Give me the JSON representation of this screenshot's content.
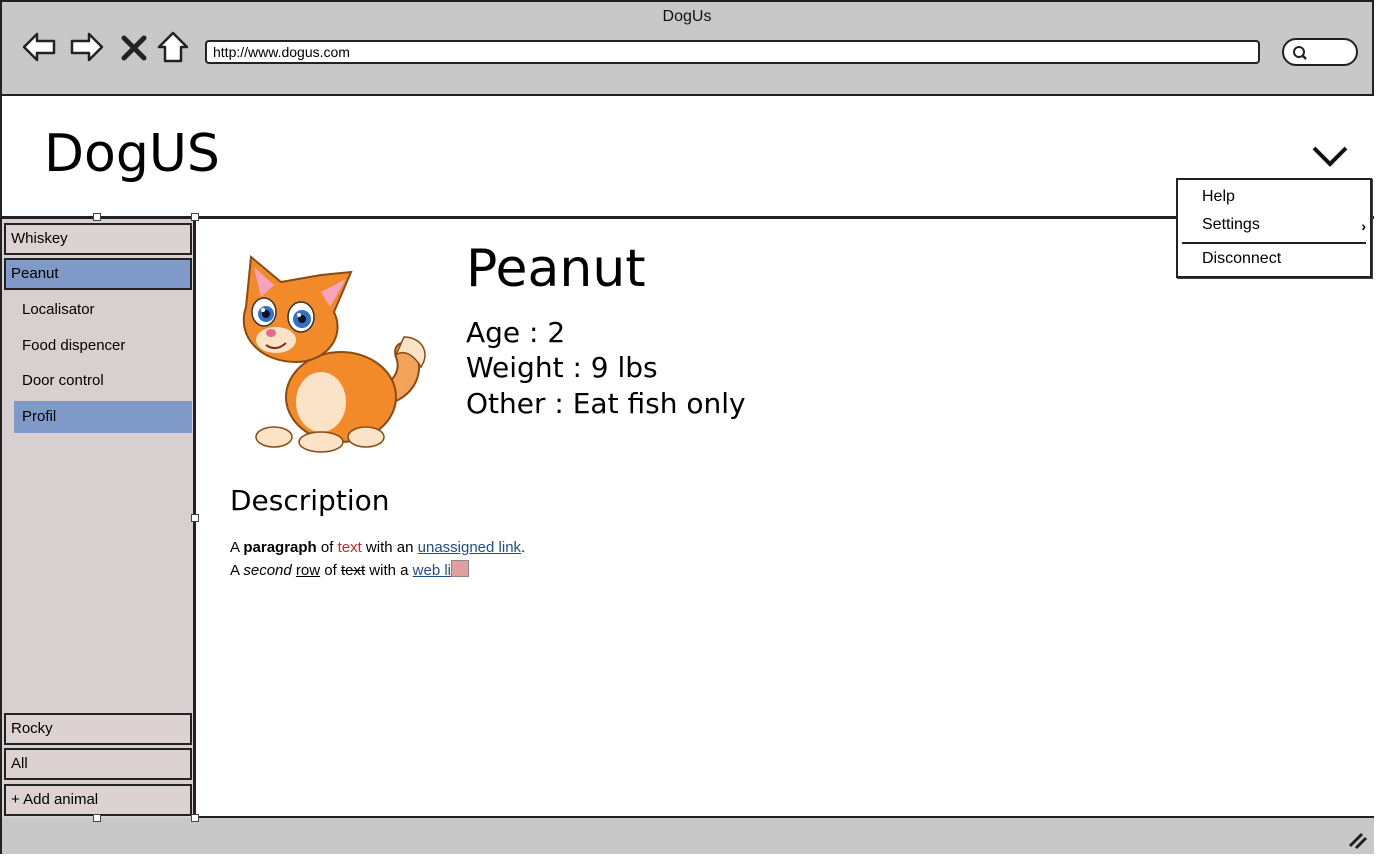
{
  "browser": {
    "title": "DogUs",
    "url": "http://www.dogus.com",
    "nav": [
      "back-icon",
      "forward-icon",
      "close-icon",
      "home-icon"
    ],
    "search_icon": "search-icon"
  },
  "header": {
    "logo": "DogUS",
    "menu_icon": "chevron-down-icon"
  },
  "menu": {
    "items": [
      {
        "label": "Help"
      },
      {
        "label": "Settings",
        "submenu_icon": "chevron-right-icon"
      },
      {
        "label": "Disconnect"
      }
    ]
  },
  "sidebar": {
    "animals_top": [
      {
        "label": "Whiskey",
        "active": false
      },
      {
        "label": "Peanut",
        "active": true
      }
    ],
    "subitems": [
      {
        "label": "Localisator",
        "active": false
      },
      {
        "label": "Food dispencer",
        "active": false
      },
      {
        "label": "Door control",
        "active": false
      },
      {
        "label": "Profil",
        "active": true
      }
    ],
    "animals_bottom": [
      {
        "label": "Rocky"
      },
      {
        "label": "All"
      },
      {
        "label": "+ Add animal"
      }
    ]
  },
  "profile": {
    "name": "Peanut",
    "age": "Age : 2",
    "weight": "Weight : 9 lbs",
    "other": "Other : Eat fish only",
    "description_title": "Description",
    "line1": {
      "a": "A ",
      "bold": "paragraph",
      "of": " of ",
      "red": "text",
      "with": " with an ",
      "link": "unassigned link",
      "end": "."
    },
    "line2": {
      "a": "A ",
      "italic": "second",
      "sp": " ",
      "underline": "row",
      "of": " of ",
      "strike": "text",
      "with": " with a ",
      "link": "web li"
    }
  },
  "colors": {
    "active": "#7f99c8",
    "sidebar_bg": "#d8d0d0",
    "chrome": "#c8c8c8",
    "link": "#1f4e8c",
    "red_text": "#c62828"
  }
}
